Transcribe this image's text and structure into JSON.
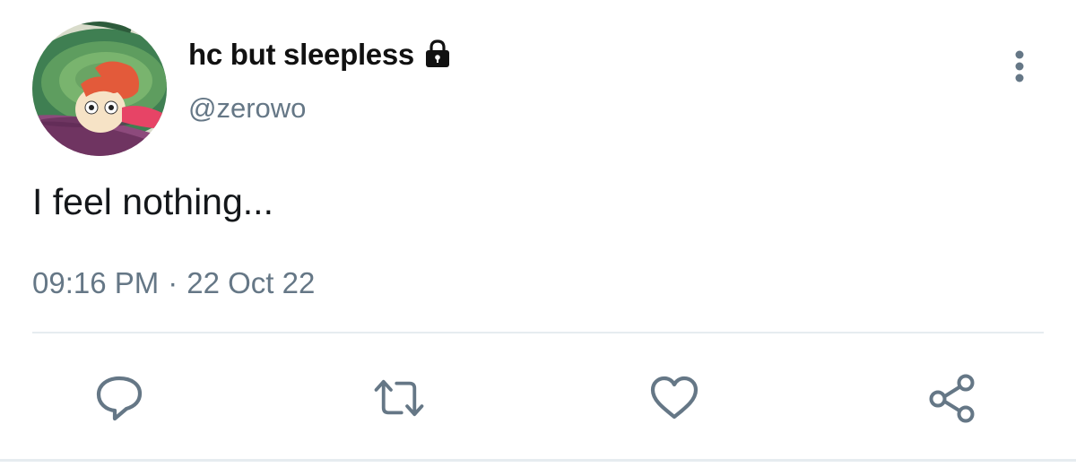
{
  "user": {
    "display_name": "hc but sleepless",
    "handle": "@zerowo",
    "protected": true,
    "avatar": "avatar"
  },
  "tweet": {
    "text": "I feel nothing...",
    "time": "09:16 PM",
    "separator": "·",
    "date": "22 Oct 22"
  },
  "icons": {
    "lock": "lock-icon",
    "more": "more-vertical-icon",
    "reply": "reply-icon",
    "retweet": "retweet-icon",
    "like": "heart-icon",
    "share": "share-icon"
  },
  "colors": {
    "icon_gray": "#657786",
    "text_primary": "#14171a",
    "divider": "#e6ecf0"
  }
}
